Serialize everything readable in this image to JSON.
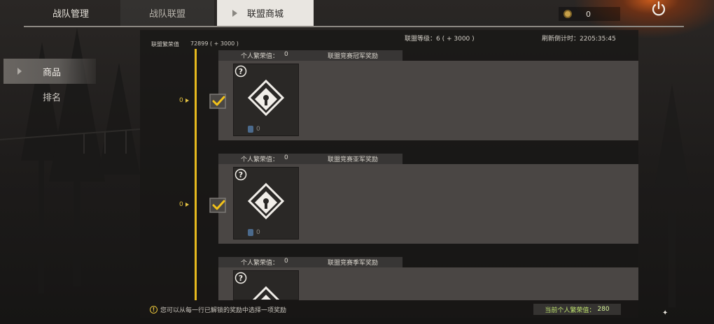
{
  "tabs": {
    "manage": "战队管理",
    "alliance": "战队联盟",
    "shop": "联盟商城"
  },
  "currency": {
    "value": "0",
    "icon": "coin-icon"
  },
  "side_nav": {
    "items": [
      {
        "label": "商品"
      },
      {
        "label": "排名"
      }
    ]
  },
  "header": {
    "prosperity_label": "联盟繁荣值",
    "prosperity_value": "72899 ( + 3000 )",
    "level": "联盟等级：6 ( + 3000 )",
    "timer": "刷新倒计时：2205:35:45"
  },
  "rows": [
    {
      "num": "0",
      "personal_label": "个人繁荣值：",
      "personal_value": "0",
      "reward": "联盟竞赛冠军奖励",
      "count": "0"
    },
    {
      "num": "0",
      "personal_label": "个人繁荣值：",
      "personal_value": "0",
      "reward": "联盟竞赛亚军奖励",
      "count": "0"
    },
    {
      "num": "",
      "personal_label": "个人繁荣值：",
      "personal_value": "0",
      "reward": "联盟竞赛季军奖励",
      "count": ""
    }
  ],
  "footer": {
    "tip": "您可以从每一行已解锁的奖励中选择一项奖励",
    "current_label": "当前个人繁荣值：",
    "current_value": "280"
  },
  "colors": {
    "accent": "#e6b91e",
    "active_tab": "#e9e6e1",
    "positive_text": "#bfe36e"
  }
}
